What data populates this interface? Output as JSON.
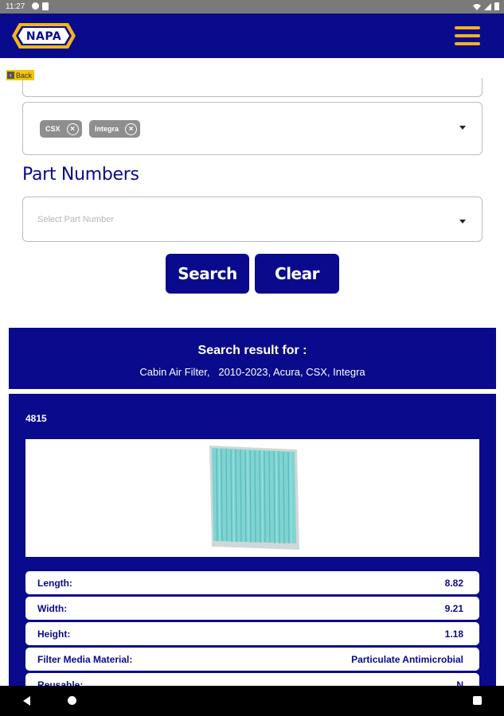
{
  "status_bar": {
    "time": "11:27",
    "icons": [
      "gear-icon",
      "sd-card-icon",
      "wifi-icon",
      "signal-icon",
      "battery-icon"
    ]
  },
  "header": {
    "logo_text": "NAPA",
    "brand_color": "#0a0a8c",
    "accent_color": "#f4b41a",
    "menu_icon": "hamburger-menu-icon"
  },
  "back": {
    "label": "Back"
  },
  "filters": {
    "selected_chips": [
      {
        "label": "CSX"
      },
      {
        "label": "Integra"
      }
    ]
  },
  "part_numbers": {
    "title": "Part Numbers",
    "placeholder": "Select Part Number"
  },
  "actions": {
    "search_label": "Search",
    "clear_label": "Clear"
  },
  "result": {
    "title": "Search result for :",
    "subtitle": "Cabin Air Filter,   2010-2023, Acura, CSX, Integra"
  },
  "product": {
    "part_number": "4815",
    "image_alt": "cabin-air-filter-image",
    "specs": [
      {
        "label": "Length:",
        "value": "8.82"
      },
      {
        "label": "Width:",
        "value": "9.21"
      },
      {
        "label": "Height:",
        "value": "1.18"
      },
      {
        "label": "Filter Media Material:",
        "value": "Particulate Antimicrobial"
      },
      {
        "label": "Reusable:",
        "value": "N"
      }
    ]
  }
}
